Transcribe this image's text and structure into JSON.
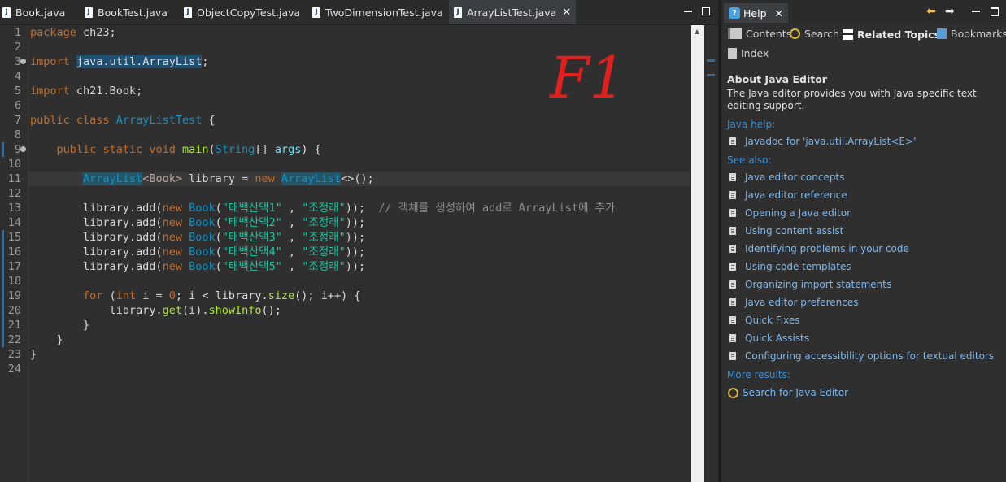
{
  "editor_tabs": [
    {
      "label": "Book.java",
      "active": false
    },
    {
      "label": "BookTest.java",
      "active": false
    },
    {
      "label": "ObjectCopyTest.java",
      "active": false
    },
    {
      "label": "TwoDimensionTest.java",
      "active": false
    },
    {
      "label": "ArrayListTest.java",
      "active": true
    }
  ],
  "tab_icon_letter": "J",
  "line_numbers": [
    "1",
    "2",
    "3",
    "4",
    "5",
    "6",
    "7",
    "8",
    "9",
    "10",
    "11",
    "12",
    "13",
    "14",
    "15",
    "16",
    "17",
    "18",
    "19",
    "20",
    "21",
    "22",
    "23",
    "24"
  ],
  "code": {
    "kw_package": "package",
    "pkg_name": "ch23;",
    "kw_import": "import",
    "import1": "java.util.ArrayList",
    "semi": ";",
    "import2": "ch21.Book;",
    "kw_public": "public",
    "kw_class": "class",
    "class_name": "ArrayListTest",
    "brace_open": " {",
    "kw_static": "static",
    "kw_void": "void",
    "method_main": "main",
    "paren_open": "(",
    "type_string": "String",
    "array_args": "[] ",
    "param_args": "args",
    "paren_close_brace": ") {",
    "type_arraylist_a": "Arr",
    "type_arraylist_b": "ayList",
    "generic_book": "<Book>",
    "var_library": " library = ",
    "kw_new": "new",
    "ctor_arraylist": "ArrayList",
    "diamond_end": "<>();",
    "library_add": "library.add(",
    "type_book": "Book",
    "book_open": "(",
    "title1": "\"태백산맥1\"",
    "title2": "\"태백산맥2\"",
    "title3": "\"태백산맥3\"",
    "title4": "\"태백산맥4\"",
    "title5": "\"태백산맥5\"",
    "comma": " , ",
    "author": "\"조정래\"",
    "add_close": "));",
    "comment": "// 객체를 생성하여 add로 ArrayList에 추가",
    "kw_for": "for",
    "for_open": " (",
    "kw_int": "int",
    "for_i_init": " i = ",
    "zero": "0",
    "for_cond": "; i < library.",
    "method_size": "size",
    "for_rest": "(); i++) {",
    "get_prefix": "library.",
    "method_get": "get",
    "get_mid": "(i).",
    "method_showinfo": "showInfo",
    "get_end": "();",
    "close_brace": "}"
  },
  "annotation_text": "F1",
  "help": {
    "tab_label": "Help",
    "tab_icon": "?",
    "nav_contents": "Contents",
    "nav_search": "Search",
    "nav_related": "Related Topics",
    "nav_bookmarks": "Bookmarks",
    "nav_index": "Index",
    "title": "About Java Editor",
    "description": "The Java editor provides you with Java specific text editing support.",
    "section_java_help": "Java help:",
    "javadoc_link": "Javadoc for 'java.util.ArrayList<E>'",
    "section_see_also": "See also:",
    "see_also": [
      "Java editor concepts",
      "Java editor reference",
      "Opening a Java editor",
      "Using content assist",
      "Identifying problems in your code",
      "Using code templates",
      "Organizing import statements",
      "Java editor preferences",
      "Quick Fixes",
      "Quick Assists",
      "Configuring accessibility options for textual editors"
    ],
    "section_more_results": "More results:",
    "search_link": "Search for Java Editor"
  },
  "colors": {
    "keyword": "#cc6c1d",
    "type": "#1290c3",
    "string": "#17c6a3",
    "link": "#79b8f2",
    "annotation": "#e0201e"
  },
  "icons": {
    "tab_close": "close-icon",
    "help": "help-icon",
    "back": "back-arrow-icon",
    "forward": "forward-arrow-icon",
    "minimize": "minimize-icon",
    "maximize": "maximize-icon",
    "doc": "document-icon"
  }
}
